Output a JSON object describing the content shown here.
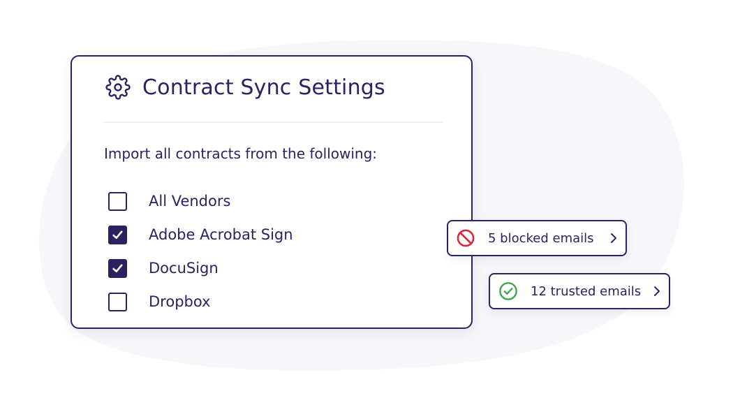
{
  "settings": {
    "title": "Contract Sync Settings",
    "icon": "gear-icon",
    "intro": "Import all contracts from the following:",
    "options": [
      {
        "label": "All Vendors",
        "checked": false
      },
      {
        "label": "Adobe Acrobat Sign",
        "checked": true
      },
      {
        "label": "DocuSign",
        "checked": true
      },
      {
        "label": "Dropbox",
        "checked": false
      }
    ]
  },
  "badges": {
    "blocked": {
      "label": "5 blocked emails",
      "icon": "blocked-icon",
      "color": "#d6263a"
    },
    "trusted": {
      "label": "12 trusted emails",
      "icon": "check-circle-icon",
      "color": "#3fa34d"
    }
  },
  "colors": {
    "primary": "#2b2262",
    "background_blob": "#f6f6fb"
  }
}
